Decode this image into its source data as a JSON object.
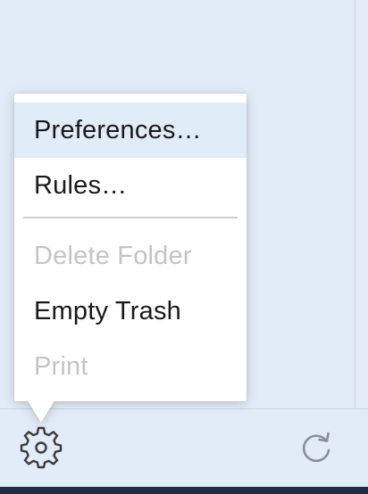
{
  "menu": {
    "items": [
      {
        "label": "Preferences…",
        "enabled": true,
        "highlighted": true
      },
      {
        "label": "Rules…",
        "enabled": true,
        "highlighted": false
      },
      {
        "label": "Delete Folder",
        "enabled": false,
        "highlighted": false
      },
      {
        "label": "Empty Trash",
        "enabled": true,
        "highlighted": false
      },
      {
        "label": "Print",
        "enabled": false,
        "highlighted": false
      }
    ]
  },
  "toolbar": {
    "left_icon": "gear-icon",
    "right_icon": "refresh-icon"
  },
  "colors": {
    "background": "#e2ecf8",
    "menu_background": "#ffffff",
    "highlight": "#e1ecf9",
    "text": "#1a1a1a",
    "disabled_text": "#c4c4c4",
    "icon": "#3b3b3b"
  }
}
